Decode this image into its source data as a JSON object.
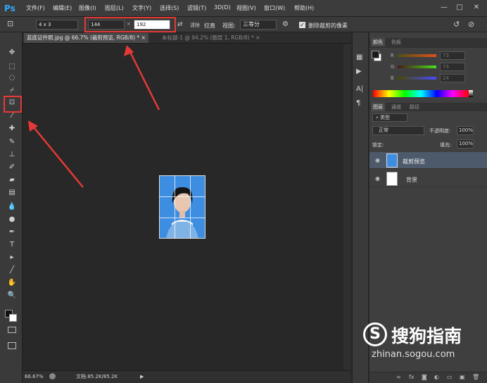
{
  "app": {
    "logo": "Ps"
  },
  "menu": [
    "文件(F)",
    "编辑(E)",
    "图像(I)",
    "图层(L)",
    "文字(Y)",
    "选择(S)",
    "滤镜(T)",
    "3D(D)",
    "视图(V)",
    "窗口(W)",
    "帮助(H)"
  ],
  "window_controls": [
    "—",
    "□",
    "✕"
  ],
  "options": {
    "ratio": "4 x 3",
    "width": "144",
    "height": "192",
    "swap": "⇄",
    "clear_label": "清除",
    "straighten_label": "拉直",
    "view_label": "视图:",
    "view_value": "三等分",
    "delete_cropped_label": "删除裁剪的像素",
    "delete_cropped_checked": true
  },
  "tabs": [
    {
      "label": "蓝底证件照.jpg @ 66.7% (裁剪预览, RGB/8) *",
      "close": "×",
      "active": true
    },
    {
      "label": "未标题-1 @ 94.2% (图层 1, RGB/8) *",
      "close": "×",
      "active": false
    }
  ],
  "toolbar_icons": [
    "move-icon",
    "marquee-icon",
    "lasso-icon",
    "quick-select-icon",
    "crop-icon",
    "eyedropper-icon",
    "healing-icon",
    "brush-icon",
    "stamp-icon",
    "history-brush-icon",
    "eraser-icon",
    "gradient-icon",
    "blur-icon",
    "dodge-icon",
    "pen-icon",
    "type-icon",
    "path-select-icon",
    "shape-icon",
    "hand-icon",
    "zoom-icon"
  ],
  "toolbar_glyphs": [
    "✥",
    "⬚",
    "◌",
    "⌿",
    "⊡",
    "⁄",
    "✚",
    "✎",
    "⊥",
    "✐",
    "▰",
    "▤",
    "💧",
    "●",
    "✒",
    "T",
    "▸",
    "╱",
    "✋",
    "🔍"
  ],
  "status": {
    "zoom": "66.67%",
    "doc": "文档:85.2K/85.2K",
    "arrow": "▶"
  },
  "color_panel": {
    "tabs": [
      "颜色",
      "色板"
    ],
    "channels": [
      {
        "label": "R",
        "value": "73"
      },
      {
        "label": "G",
        "value": "73"
      },
      {
        "label": "B",
        "value": "24"
      }
    ]
  },
  "layers_panel": {
    "tabs": [
      "图层",
      "通道",
      "路径"
    ],
    "filter_label": "类型",
    "blend_mode": "正常",
    "opacity_label": "不透明度:",
    "opacity_value": "100%",
    "lock_label": "锁定:",
    "fill_label": "填充:",
    "fill_value": "100%",
    "layers": [
      {
        "name": "裁剪预览",
        "selected": true
      },
      {
        "name": "背景",
        "selected": false
      }
    ],
    "bottom_icons": [
      "link-icon",
      "fx-icon",
      "mask-icon",
      "adjust-icon",
      "folder-icon",
      "new-layer-icon",
      "trash-icon"
    ],
    "bottom_glyphs": [
      "∞",
      "fx",
      "◙",
      "◐",
      "▭",
      "▣",
      "🗑"
    ]
  },
  "watermark": {
    "brand": "搜狗指南",
    "url": "zhinan.sogou.com",
    "logo": "S"
  },
  "colors": {
    "accent": "#e53935",
    "selected_layer": "#4d5a6b",
    "photo_bg": "#3d8de0"
  }
}
